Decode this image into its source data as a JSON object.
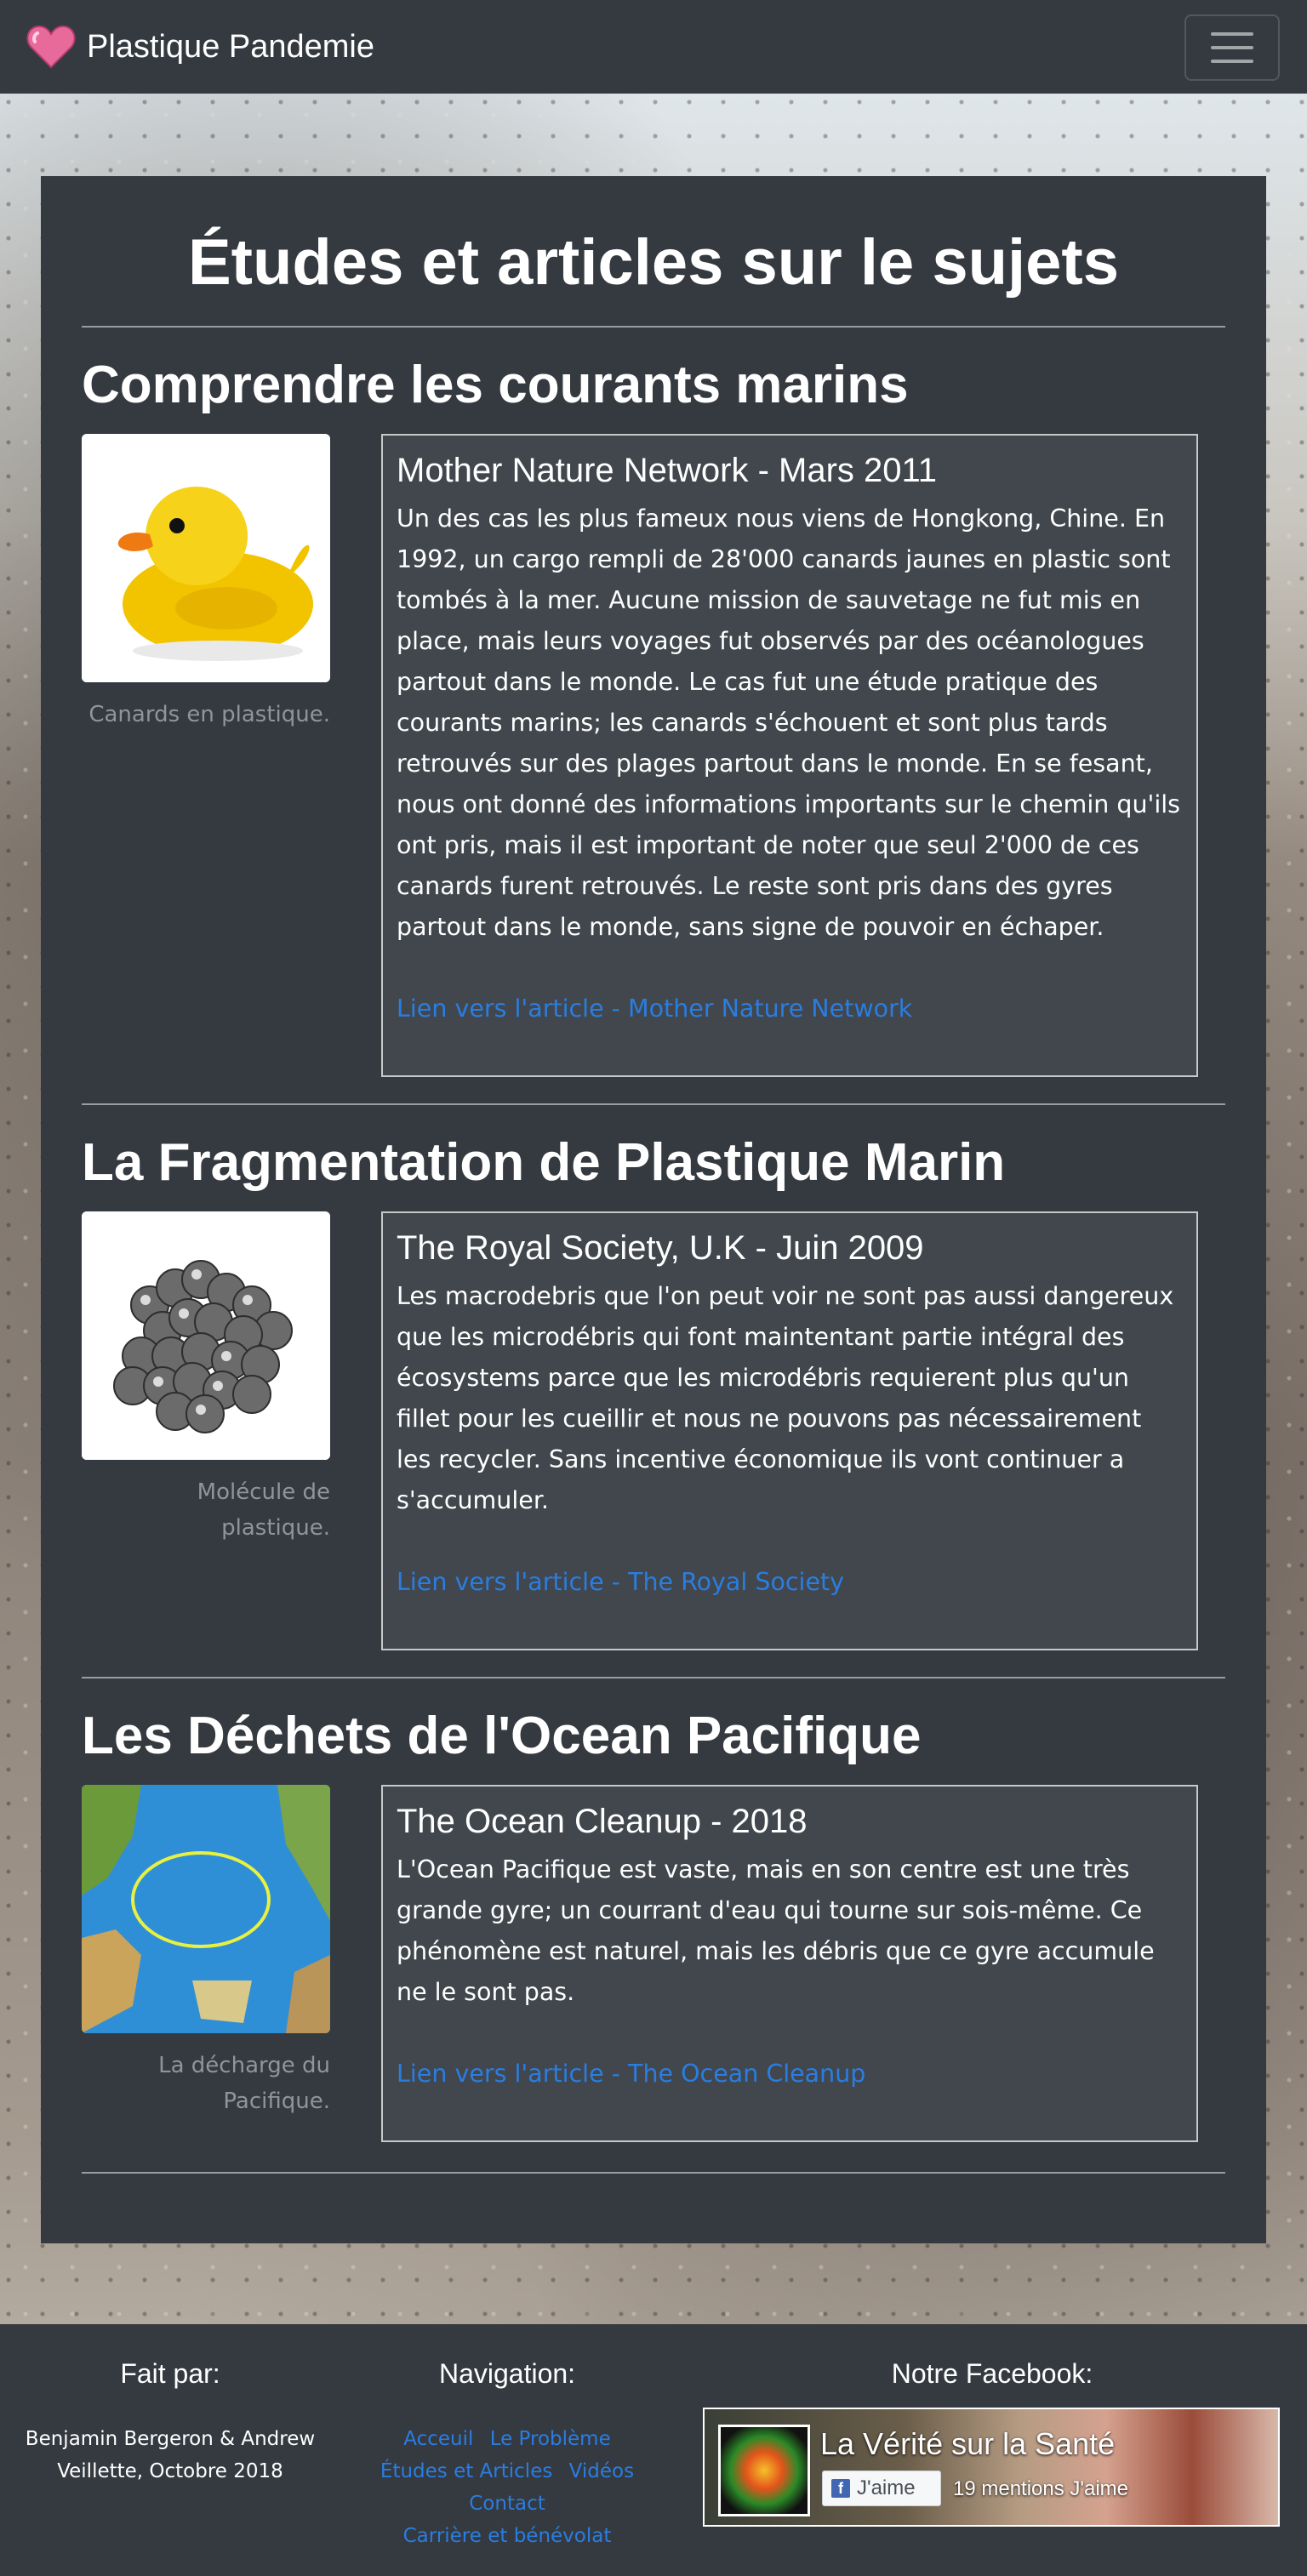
{
  "header": {
    "brand": "Plastique Pandemie",
    "brand_icon": "heart-icon",
    "menu_icon": "hamburger-menu-icon"
  },
  "page_title": "Études et articles sur le sujets",
  "sections": [
    {
      "title": "Comprendre les courants marins",
      "image_icon": "rubber-duck-image",
      "caption": "Canards en plastique.",
      "card_title": "Mother Nature Network - Mars 2011",
      "text": "Un des cas les plus fameux nous viens de Hongkong, Chine. En 1992, un cargo rempli de 28'000 canards jaunes en plastic sont tombés à la mer. Aucune mission de sauvetage ne fut mis en place, mais leurs voyages fut observés par des océanologues partout dans le monde. Le cas fut une étude pratique des courants marins; les canards s'échouent et sont plus tards retrouvés sur des plages partout dans le monde. En se fesant, nous ont donné des informations importants sur le chemin qu'ils ont pris, mais il est important de noter que seul 2'000 de ces canards furent retrouvés. Le reste sont pris dans des gyres partout dans le monde, sans signe de pouvoir en échaper.",
      "link": "Lien vers l'article - Mother Nature Network"
    },
    {
      "title": "La Fragmentation de Plastique Marin",
      "image_icon": "plastic-molecule-image",
      "caption": "Molécule de plastique.",
      "card_title": "The Royal Society, U.K - Juin 2009",
      "text": "Les macrodebris que l'on peut voir ne sont pas aussi dangereux que les microdébris qui font maintentant partie intégral des écosystems parce que les microdébris requierent plus qu'un fillet pour les cueillir et nous ne pouvons pas nécessairement les recycler. Sans incentive économique ils vont continuer a s'accumuler.",
      "link": "Lien vers l'article - The Royal Society"
    },
    {
      "title": "Les Déchets de l'Ocean Pacifique",
      "image_icon": "pacific-map-image",
      "caption": "La décharge du Pacifique.",
      "card_title": "The Ocean Cleanup - 2018",
      "text": "L'Ocean Pacifique est vaste, mais en son centre est une très grande gyre; un courrant d'eau qui tourne sur sois-même. Ce phénomène est naturel, mais les débris que ce gyre accumule ne le sont pas.",
      "link": "Lien vers l'article - The Ocean Cleanup"
    }
  ],
  "footer": {
    "made_by_heading": "Fait par:",
    "authors_line1": "Benjamin Bergeron & Andrew",
    "authors_line2": "Veillette, Octobre 2018",
    "nav_heading": "Navigation:",
    "nav_links": [
      "Acceuil",
      "Le Problème",
      "Études et Articles",
      "Vidéos",
      "Contact",
      "Carrière et bénévolat"
    ],
    "facebook_heading": "Notre Facebook:",
    "facebook": {
      "page_name": "La Vérité sur la Santé",
      "like_label": "J'aime",
      "like_count": "19 mentions J'aime"
    }
  },
  "colors": {
    "navbar": "#343a40",
    "panel": "#343a40",
    "card": "#41474d",
    "link": "#2a7de1",
    "caption": "#8e959b"
  }
}
